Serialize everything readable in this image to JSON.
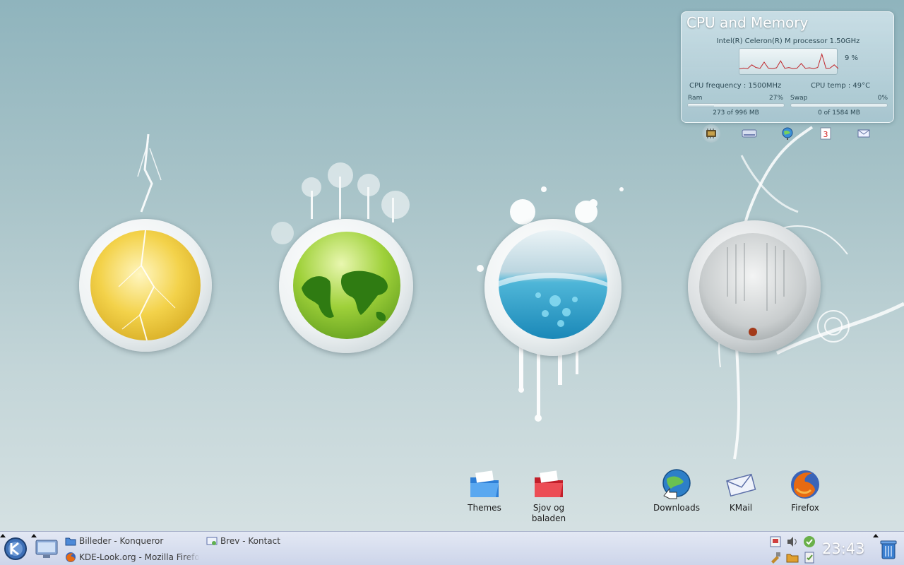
{
  "cpu_widget": {
    "title": "CPU and Memory",
    "processor": "Intel(R) Celeron(R) M processor 1.50GHz",
    "cpu_percent": "9 %",
    "cpu_frequency": "CPU frequency : 1500MHz",
    "cpu_temp": "CPU temp : 49°C",
    "ram_label": "Ram",
    "ram_percent": "27%",
    "ram_usage_fraction": 0.27,
    "ram_text": "273 of 996 MB",
    "swap_label": "Swap",
    "swap_percent": "0%",
    "swap_usage_fraction": 0.0,
    "swap_text": "0 of 1584 MB",
    "tabs": [
      "cpu-chip-icon",
      "drive-icon",
      "network-globe-icon",
      "calendar-icon",
      "mail-envelope-icon"
    ],
    "calendar_day": "3"
  },
  "desktop_icons": [
    {
      "label": "Themes",
      "icon": "blue-folder-icon"
    },
    {
      "label": "Sjov og baladen",
      "icon": "red-folder-icon"
    },
    {
      "label": "Downloads",
      "icon": "globe-download-icon"
    },
    {
      "label": "KMail",
      "icon": "envelope-icon"
    },
    {
      "label": "Firefox",
      "icon": "firefox-icon"
    }
  ],
  "taskbar": {
    "tasks": [
      {
        "label": "Billeder - Konqueror",
        "icon": "folder-icon"
      },
      {
        "label": "Brev - Kontact",
        "icon": "kontact-icon"
      },
      {
        "label": "KDE-Look.org - Mozilla Firefo",
        "icon": "firefox-icon"
      }
    ],
    "clock": "23:43"
  },
  "colors": {
    "desktop_top": "#8fb4bd",
    "desktop_bottom": "#d8e3e4",
    "taskbar": "#cdd5ea",
    "graph_line": "#c0262b"
  }
}
